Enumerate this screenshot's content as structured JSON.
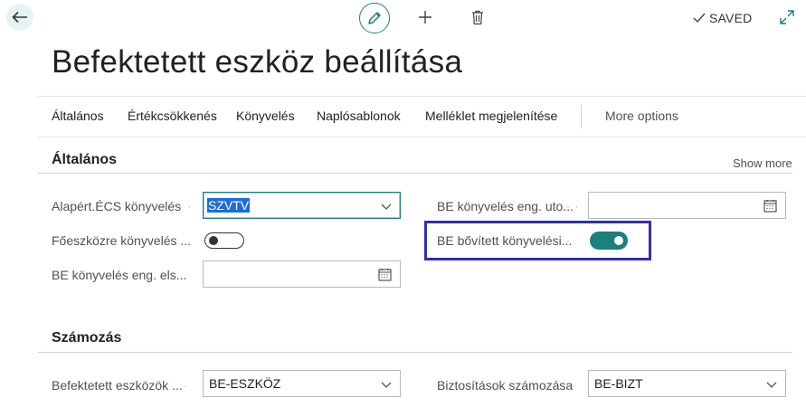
{
  "header": {
    "saved_label": "SAVED",
    "title": "Befektetett eszköz beállítása"
  },
  "actions": [
    {
      "label": "Általános"
    },
    {
      "label": "Értékcsökkenés"
    },
    {
      "label": "Könyvelés"
    },
    {
      "label": "Naplósablonok"
    },
    {
      "label": "Melléklet megjelenítése"
    },
    {
      "label": "More options"
    }
  ],
  "general": {
    "title": "Általános",
    "show_more": "Show more",
    "fields": {
      "default_depr_posting": {
        "label": "Alapért.ÉCS könyvelés",
        "value": "SZVTV"
      },
      "post_to_main_asset": {
        "label": "Főeszközre könyvelés ...",
        "value": false
      },
      "allow_posting_from": {
        "label": "BE könyvelés eng. els...",
        "value": ""
      },
      "allow_posting_to": {
        "label": "BE könyvelés eng. uto...",
        "value": ""
      },
      "extended_posting": {
        "label": "BE bővített könyvelési...",
        "value": true
      }
    }
  },
  "numbering": {
    "title": "Számozás",
    "fields": {
      "fixed_asset_nos": {
        "label": "Befektetett eszközök ...",
        "value": "BE-ESZKÖZ"
      },
      "insurance_nos": {
        "label": "Biztosítások számozása",
        "value": "BE-BIZT"
      }
    }
  },
  "colors": {
    "accent": "#1e7f7f",
    "focus_border": "#2e2eb8",
    "selection": "#1b6ed8"
  },
  "icons": [
    "back-arrow-icon",
    "pencil-icon",
    "plus-icon",
    "trash-icon",
    "checkmark-icon",
    "expand-icon",
    "chevron-down-icon",
    "calendar-icon"
  ]
}
